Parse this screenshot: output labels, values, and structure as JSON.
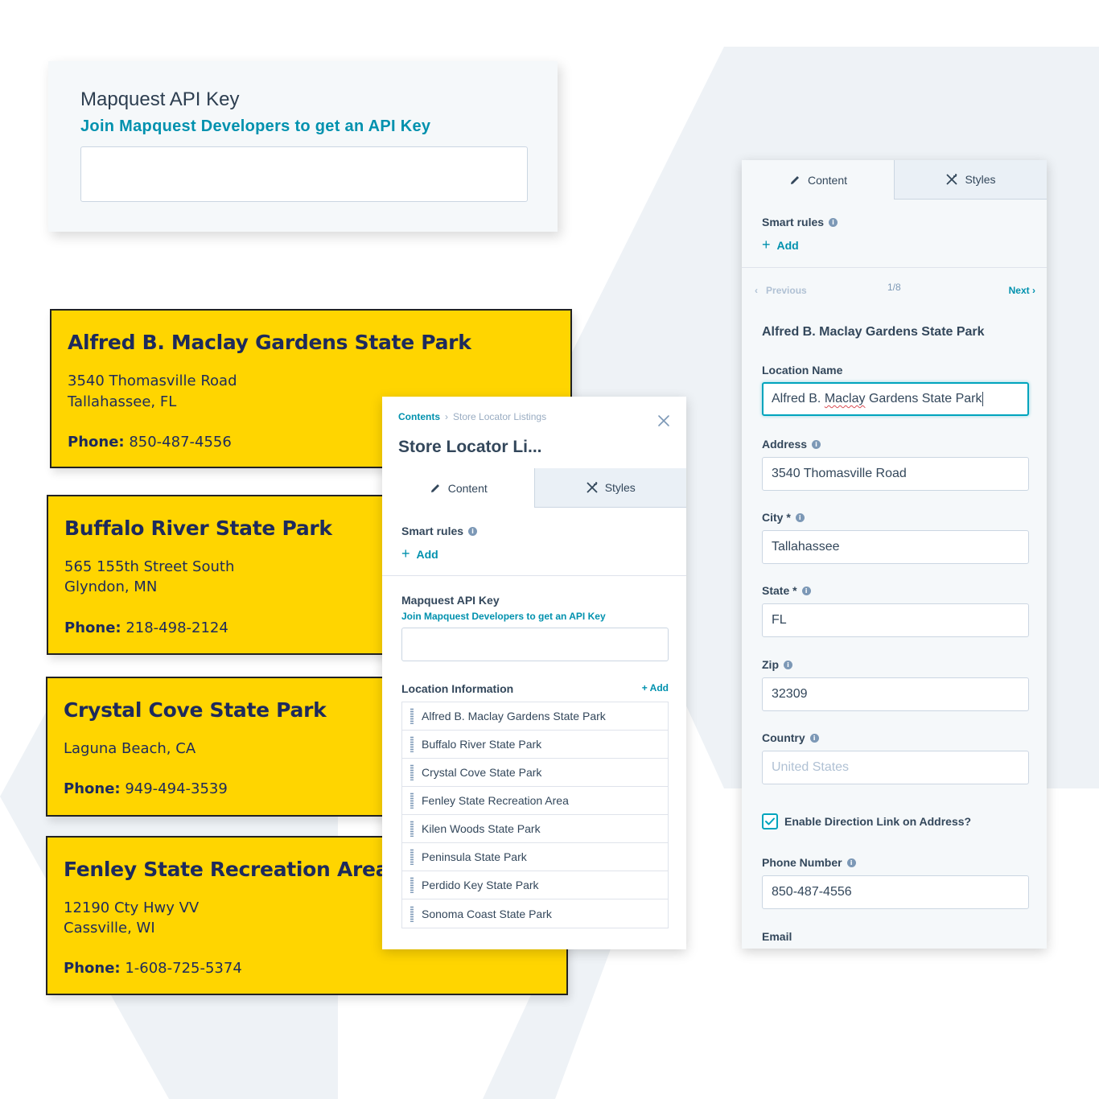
{
  "api_card": {
    "title": "Mapquest API Key",
    "link": "Join Mapquest Developers to get an API Key",
    "input_value": ""
  },
  "location_cards": [
    {
      "name": "Alfred B. Maclay Gardens State Park",
      "address1": "3540 Thomasville Road",
      "address2": "Tallahassee, FL",
      "phone_label": "Phone:",
      "phone": "850-487-4556"
    },
    {
      "name": "Buffalo River State Park",
      "address1": "565 155th Street South",
      "address2": "Glyndon, MN",
      "phone_label": "Phone:",
      "phone": "218-498-2124"
    },
    {
      "name": "Crystal Cove State Park",
      "address1": "Laguna Beach, CA",
      "address2": "",
      "phone_label": "Phone:",
      "phone": "949-494-3539"
    },
    {
      "name": "Fenley State Recreation Area",
      "address1": "12190 Cty Hwy VV",
      "address2": "Cassville, WI",
      "phone_label": "Phone:",
      "phone": "1-608-725-5374"
    }
  ],
  "mid_panel": {
    "breadcrumb": {
      "root": "Contents",
      "current": "Store Locator Listings"
    },
    "title": "Store Locator Li...",
    "tabs": {
      "content": "Content",
      "styles": "Styles"
    },
    "smart_rules": "Smart rules",
    "add": "Add",
    "api_label": "Mapquest API Key",
    "api_link": "Join Mapquest Developers to get an API Key",
    "location_info_label": "Location Information",
    "location_info_add": "+ Add",
    "locations": [
      "Alfred B. Maclay Gardens State Park",
      "Buffalo River State Park",
      "Crystal Cove State Park",
      "Fenley State Recreation Area",
      "Kilen Woods State Park",
      "Peninsula State Park",
      "Perdido Key State Park",
      "Sonoma Coast State Park"
    ]
  },
  "right_panel": {
    "tabs": {
      "content": "Content",
      "styles": "Styles"
    },
    "smart_rules": "Smart rules",
    "add": "Add",
    "pager": {
      "previous": "Previous",
      "count": "1/8",
      "next": "Next"
    },
    "title": "Alfred B. Maclay Gardens State Park",
    "fields": {
      "location_name": {
        "label": "Location Name",
        "value_a": "Alfred B. ",
        "value_b": "Maclay",
        "value_c": " Gardens State Park"
      },
      "address": {
        "label": "Address",
        "value": "3540 Thomasville Road"
      },
      "city": {
        "label": "City *",
        "value": "Tallahassee"
      },
      "state": {
        "label": "State *",
        "value": "FL"
      },
      "zip": {
        "label": "Zip",
        "value": "32309"
      },
      "country": {
        "label": "Country",
        "placeholder": "United States"
      },
      "direction_link": {
        "label": "Enable Direction Link on Address?",
        "checked": true
      },
      "phone": {
        "label": "Phone Number",
        "value": "850-487-4556"
      },
      "email": {
        "label": "Email"
      }
    }
  },
  "colors": {
    "card_yellow": "#ffd500",
    "card_text_navy": "#1d2a5c",
    "link_teal": "#0091ae",
    "focus_teal": "#00a4bd",
    "panel_bg": "#f5f8fa",
    "hex_bg": "#eef2f6"
  },
  "icons": [
    "pencil-icon",
    "styles-icon",
    "info-icon",
    "plus-icon",
    "close-icon",
    "chevron-left-icon",
    "chevron-right-icon",
    "grip-icon",
    "checkmark-icon"
  ]
}
